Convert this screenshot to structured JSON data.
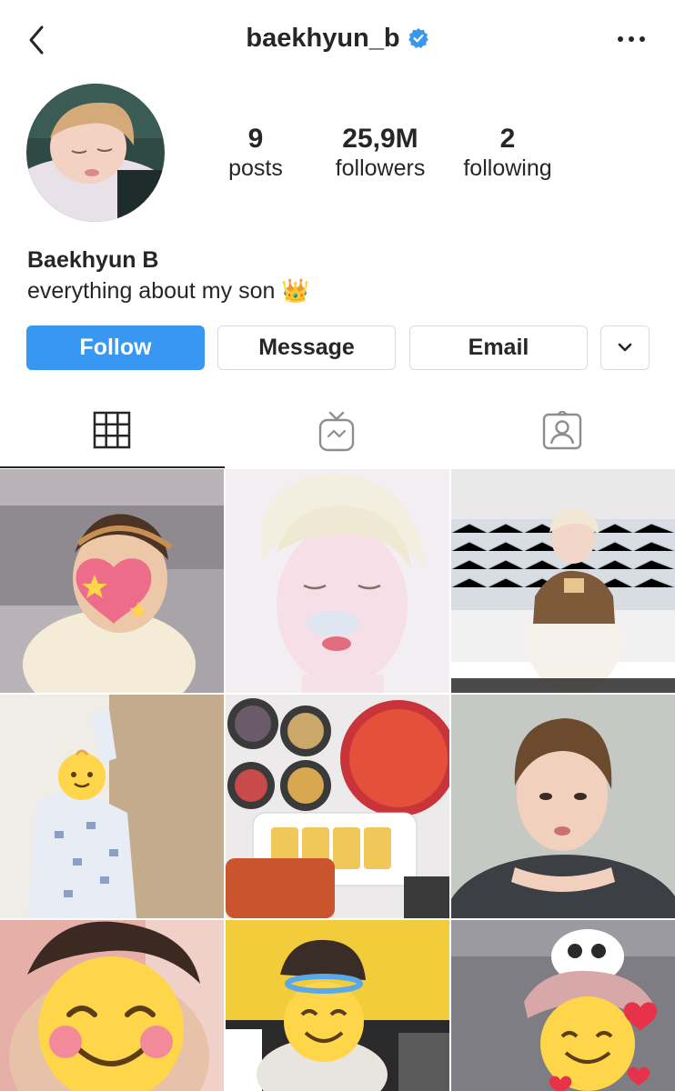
{
  "header": {
    "username": "baekhyun_b",
    "verified_icon": "verified-badge-icon",
    "back_icon": "chevron-left-icon",
    "more_icon": "more-dots-icon"
  },
  "profile": {
    "stats": {
      "posts_count": "9",
      "posts_label": "posts",
      "followers_count": "25,9M",
      "followers_label": "followers",
      "following_count": "2",
      "following_label": "following"
    },
    "name": "Baekhyun B",
    "bio": "everything about my son 👑"
  },
  "actions": {
    "follow_label": "Follow",
    "message_label": "Message",
    "email_label": "Email",
    "dropdown_icon": "chevron-down-icon"
  },
  "tabs": [
    {
      "icon": "grid-icon",
      "active": true
    },
    {
      "icon": "igtv-icon",
      "active": false
    },
    {
      "icon": "tagged-icon",
      "active": false
    }
  ],
  "colors": {
    "accent": "#3897f0",
    "text": "#262626",
    "border": "#dbdbdb"
  }
}
